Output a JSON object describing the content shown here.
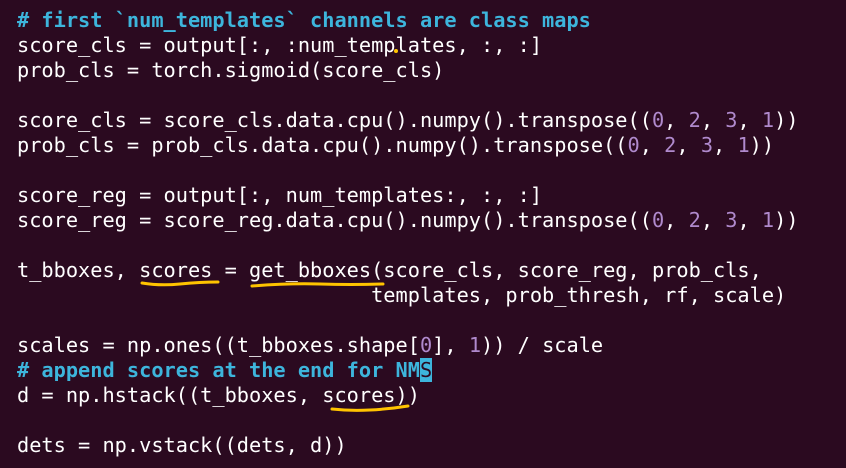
{
  "lines": [
    {
      "parts": [
        {
          "t": "# first `num_templates` channels are class maps",
          "c": "comment"
        }
      ]
    },
    {
      "parts": [
        {
          "t": "score_cls = output[:, :num_templates, :, :]"
        }
      ]
    },
    {
      "parts": [
        {
          "t": "prob_cls = torch.sigmoid(score_cls)"
        }
      ]
    },
    {
      "parts": [
        {
          "t": ""
        }
      ]
    },
    {
      "parts": [
        {
          "t": "score_cls = score_cls.data.cpu().numpy().transpose(("
        },
        {
          "t": "0",
          "c": "num"
        },
        {
          "t": ", "
        },
        {
          "t": "2",
          "c": "num"
        },
        {
          "t": ", "
        },
        {
          "t": "3",
          "c": "num"
        },
        {
          "t": ", "
        },
        {
          "t": "1",
          "c": "num"
        },
        {
          "t": "))"
        }
      ]
    },
    {
      "parts": [
        {
          "t": "prob_cls = prob_cls.data.cpu().numpy().transpose(("
        },
        {
          "t": "0",
          "c": "num"
        },
        {
          "t": ", "
        },
        {
          "t": "2",
          "c": "num"
        },
        {
          "t": ", "
        },
        {
          "t": "3",
          "c": "num"
        },
        {
          "t": ", "
        },
        {
          "t": "1",
          "c": "num"
        },
        {
          "t": "))"
        }
      ]
    },
    {
      "parts": [
        {
          "t": ""
        }
      ]
    },
    {
      "parts": [
        {
          "t": "score_reg = output[:, num_templates:, :, :]"
        }
      ]
    },
    {
      "parts": [
        {
          "t": "score_reg = score_reg.data.cpu().numpy().transpose(("
        },
        {
          "t": "0",
          "c": "num"
        },
        {
          "t": ", "
        },
        {
          "t": "2",
          "c": "num"
        },
        {
          "t": ", "
        },
        {
          "t": "3",
          "c": "num"
        },
        {
          "t": ", "
        },
        {
          "t": "1",
          "c": "num"
        },
        {
          "t": "))"
        }
      ]
    },
    {
      "parts": [
        {
          "t": ""
        }
      ]
    },
    {
      "parts": [
        {
          "t": "t_bboxes, scores = get_bboxes(score_cls, score_reg, prob_cls,"
        }
      ]
    },
    {
      "parts": [
        {
          "t": "                             templates, prob_thresh, rf, scale)"
        }
      ]
    },
    {
      "parts": [
        {
          "t": ""
        }
      ]
    },
    {
      "parts": [
        {
          "t": "scales = np.ones((t_bboxes.shape["
        },
        {
          "t": "0",
          "c": "num"
        },
        {
          "t": "], "
        },
        {
          "t": "1",
          "c": "num"
        },
        {
          "t": ")) / scale"
        }
      ]
    },
    {
      "parts": [
        {
          "t": "# append scores at the end for NM",
          "c": "comment"
        },
        {
          "t": "S",
          "c": "cursor"
        }
      ]
    },
    {
      "parts": [
        {
          "t": "d = np.hstack((t_bboxes, scores))"
        }
      ]
    },
    {
      "parts": [
        {
          "t": ""
        }
      ]
    },
    {
      "parts": [
        {
          "t": "dets = np.vstack((dets, d))"
        }
      ]
    }
  ],
  "annotation_color": "#ffc400"
}
